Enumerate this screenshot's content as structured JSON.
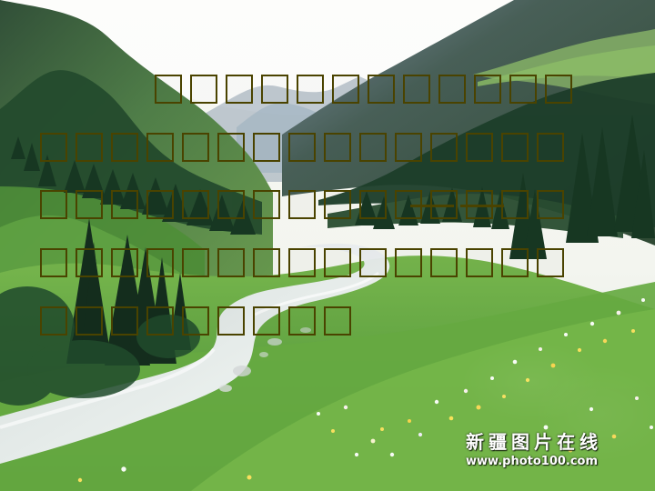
{
  "watermark": {
    "title": "新疆图片在线",
    "url": "www.photo100.com"
  },
  "text_rows": [
    {
      "glyphs": 12
    },
    {
      "glyphs": 15
    },
    {
      "glyphs": 15
    },
    {
      "glyphs": 15
    },
    {
      "glyphs": 9
    }
  ]
}
